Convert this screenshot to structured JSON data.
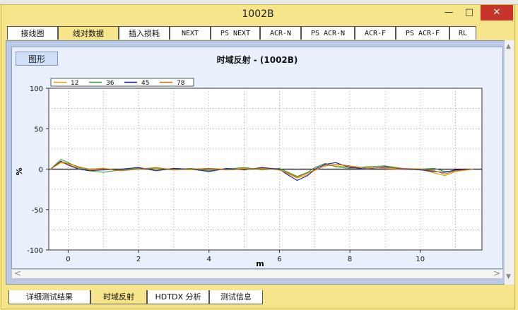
{
  "window": {
    "title": "1002B",
    "minimize": "—",
    "maximize": "□",
    "close": "✕"
  },
  "top_tabs": [
    {
      "label": "接线图",
      "active": false
    },
    {
      "label": "线对数据",
      "active": true
    },
    {
      "label": "插入损耗",
      "active": false
    },
    {
      "label": "NEXT",
      "active": false
    },
    {
      "label": "PS NEXT",
      "active": false
    },
    {
      "label": "ACR-N",
      "active": false
    },
    {
      "label": "PS ACR-N",
      "active": false
    },
    {
      "label": "ACR-F",
      "active": false
    },
    {
      "label": "PS ACR-F",
      "active": false
    },
    {
      "label": "RL",
      "active": false
    }
  ],
  "graph_button": "图形",
  "bottom_tabs": [
    {
      "label": "详细测试结果",
      "active": false
    },
    {
      "label": "时域反射",
      "active": true
    },
    {
      "label": "HDTDX 分析",
      "active": false
    },
    {
      "label": "测试信息",
      "active": false
    }
  ],
  "scroll": {
    "left": "<",
    "right": ">",
    "up": "▲",
    "down": "▼"
  },
  "colors": {
    "s12": "#e8a000",
    "s36": "#3a9a3a",
    "s45": "#1a1aa8",
    "s78": "#d07000"
  },
  "chart_data": {
    "type": "line",
    "title": "时域反射 - (1002B)",
    "xlabel": "m",
    "ylabel": "%",
    "xlim": [
      -0.55,
      11.75
    ],
    "ylim": [
      -100,
      100
    ],
    "xticks": [
      0,
      2,
      4,
      6,
      8,
      10
    ],
    "yticks": [
      100,
      50,
      0,
      -50,
      -100
    ],
    "grid": true,
    "legend_position": "top-left",
    "series": [
      {
        "name": "12",
        "color": "#e8a000",
        "x": [
          -0.5,
          -0.2,
          0,
          0.3,
          0.6,
          1,
          1.5,
          2,
          2.5,
          3,
          3.5,
          4,
          4.5,
          5,
          5.5,
          6,
          6.2,
          6.5,
          6.8,
          7,
          7.3,
          7.6,
          8,
          8.5,
          9,
          9.5,
          10,
          10.4,
          10.7,
          11,
          11.5
        ],
        "y": [
          0,
          8,
          6,
          1,
          -1,
          0,
          -1,
          0,
          1,
          0,
          -1,
          1,
          0,
          1,
          0,
          0,
          -5,
          -11,
          -7,
          -2,
          5,
          4,
          3,
          2,
          1,
          0,
          0,
          -5,
          -8,
          -3,
          0
        ]
      },
      {
        "name": "36",
        "color": "#3a9a3a",
        "x": [
          -0.5,
          -0.2,
          0,
          0.3,
          0.6,
          1,
          1.5,
          2,
          2.5,
          3,
          3.5,
          4,
          4.5,
          5,
          5.5,
          6,
          6.2,
          6.5,
          6.8,
          7,
          7.3,
          7.6,
          8,
          8.5,
          9,
          9.5,
          10,
          10.4,
          10.7,
          11,
          11.5
        ],
        "y": [
          0,
          12,
          8,
          2,
          -2,
          -4,
          -1,
          1,
          0,
          -1,
          1,
          -2,
          0,
          2,
          -1,
          1,
          -3,
          -9,
          -4,
          2,
          7,
          3,
          1,
          3,
          4,
          1,
          0,
          1,
          -3,
          -2,
          0
        ]
      },
      {
        "name": "45",
        "color": "#1a1aa8",
        "x": [
          -0.5,
          -0.2,
          0,
          0.3,
          0.6,
          1,
          1.5,
          2,
          2.5,
          3,
          3.5,
          4,
          4.5,
          5,
          5.5,
          6,
          6.2,
          6.5,
          6.8,
          7,
          7.3,
          7.6,
          8,
          8.5,
          9,
          9.5,
          10,
          10.4,
          10.7,
          11,
          11.5
        ],
        "y": [
          0,
          10,
          5,
          0,
          -2,
          -1,
          0,
          2,
          -2,
          1,
          0,
          -3,
          1,
          -1,
          2,
          0,
          -6,
          -14,
          -8,
          0,
          6,
          8,
          2,
          0,
          3,
          0,
          -1,
          -3,
          -4,
          -1,
          0
        ]
      },
      {
        "name": "78",
        "color": "#d07000",
        "x": [
          -0.5,
          -0.2,
          0,
          0.3,
          0.6,
          1,
          1.5,
          2,
          2.5,
          3,
          3.5,
          4,
          4.5,
          5,
          5.5,
          6,
          6.2,
          6.5,
          6.8,
          7,
          7.3,
          7.6,
          8,
          8.5,
          9,
          9.5,
          10,
          10.4,
          10.7,
          11,
          11.5
        ],
        "y": [
          0,
          9,
          7,
          3,
          0,
          1,
          -2,
          0,
          2,
          -1,
          0,
          1,
          -1,
          0,
          1,
          -1,
          -4,
          -10,
          -5,
          -1,
          4,
          6,
          4,
          1,
          2,
          1,
          0,
          -2,
          -6,
          -2,
          0
        ]
      }
    ]
  }
}
